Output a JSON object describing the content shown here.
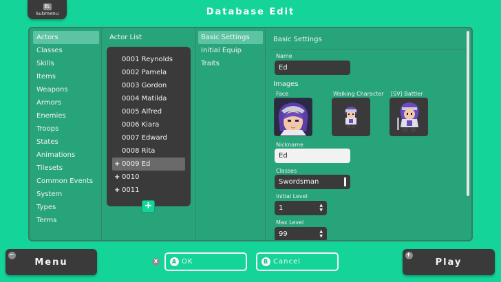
{
  "header": {
    "submenu_button": "ZL",
    "submenu_label": "Submenu",
    "title": "Database Edit"
  },
  "categories": [
    {
      "label": "Actors",
      "selected": true
    },
    {
      "label": "Classes"
    },
    {
      "label": "Skills"
    },
    {
      "label": "Items"
    },
    {
      "label": "Weapons"
    },
    {
      "label": "Armors"
    },
    {
      "label": "Enemies"
    },
    {
      "label": "Troops"
    },
    {
      "label": "States"
    },
    {
      "label": "Animations"
    },
    {
      "label": "Tilesets"
    },
    {
      "label": "Common Events"
    },
    {
      "label": "System"
    },
    {
      "label": "Types"
    },
    {
      "label": "Terms"
    }
  ],
  "actor_list": {
    "title": "Actor List",
    "items": [
      {
        "label": "0001 Reynolds"
      },
      {
        "label": "0002 Pamela"
      },
      {
        "label": "0003 Gordon"
      },
      {
        "label": "0004 Matilda"
      },
      {
        "label": "0005 Alfred"
      },
      {
        "label": "0006 Kiara"
      },
      {
        "label": "0007 Edward"
      },
      {
        "label": "0008 Rita"
      },
      {
        "label": "0009 Ed",
        "selected": true,
        "marker": "+"
      },
      {
        "label": "0010",
        "marker": "+"
      },
      {
        "label": "0011",
        "marker": "+"
      }
    ],
    "add_button": "+"
  },
  "settings_tabs": [
    {
      "label": "Basic Settings",
      "selected": true
    },
    {
      "label": "Initial Equip"
    },
    {
      "label": "Traits"
    }
  ],
  "basic_settings": {
    "title": "Basic Settings",
    "name_label": "Name",
    "name_value": "Ed",
    "images_label": "Images",
    "face_label": "Face",
    "walking_label": "Walking Character",
    "battler_label": "[SV] Battler",
    "nickname_label": "Nickname",
    "nickname_value": "Ed",
    "classes_label": "Classes",
    "classes_value": "Swordsman",
    "initial_level_label": "Initial Level",
    "initial_level_value": "1",
    "max_level_label": "Max Level",
    "max_level_value": "99"
  },
  "footer": {
    "menu_label": "Menu",
    "menu_corner": "−",
    "x_glyph": "X",
    "ok_badge": "A",
    "ok_label": "OK",
    "cancel_badge": "B",
    "cancel_label": "Cancel",
    "play_label": "Play",
    "play_corner": "+"
  },
  "colors": {
    "background": "#14d49a",
    "panel": "#28a47a",
    "dark_box": "#3a3a3a",
    "selection": "#5cc4a2"
  }
}
